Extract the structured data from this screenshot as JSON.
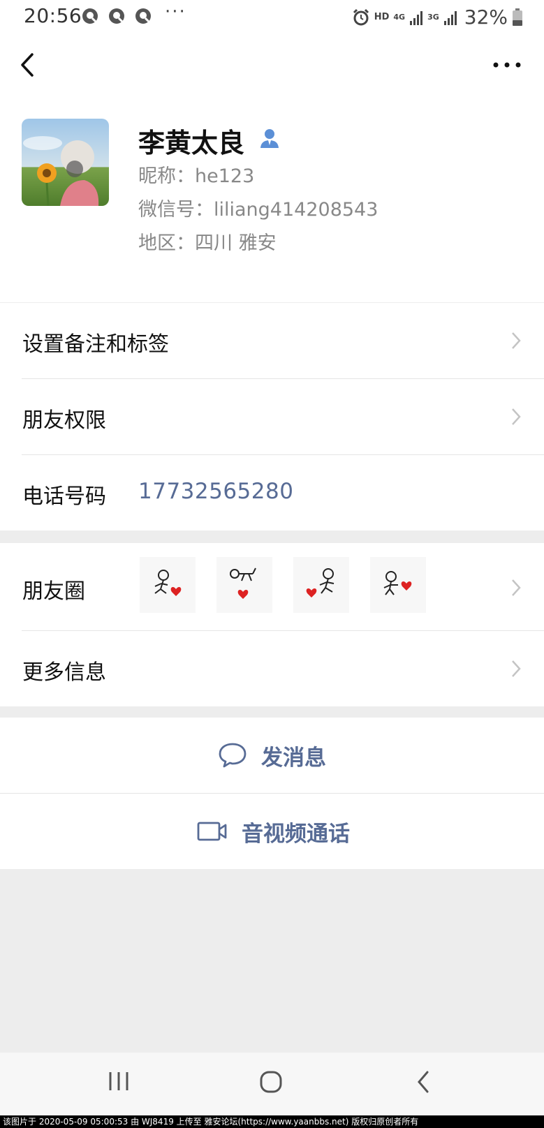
{
  "status_bar": {
    "time": "20:56",
    "hd": "HD",
    "net1": "4G",
    "net2": "3G",
    "battery": "32%"
  },
  "profile": {
    "name": "李黄太良",
    "nickname": "昵称：he123",
    "wechat_id": "微信号：liliang414208543",
    "region": "地区：四川  雅安"
  },
  "rows": {
    "remark": "设置备注和标签",
    "permissions": "朋友权限",
    "phone_label": "电话号码",
    "phone_value": "17732565280",
    "moments": "朋友圈",
    "more_info": "更多信息"
  },
  "actions": {
    "message": "发消息",
    "call": "音视频通话"
  },
  "watermark": "该图片于 2020-05-09 05:00:53 由 WJ8419 上传至 雅安论坛(https://www.yaanbbs.net) 版权归原创者所有",
  "colors": {
    "link": "#576b95",
    "background": "#ededed"
  }
}
